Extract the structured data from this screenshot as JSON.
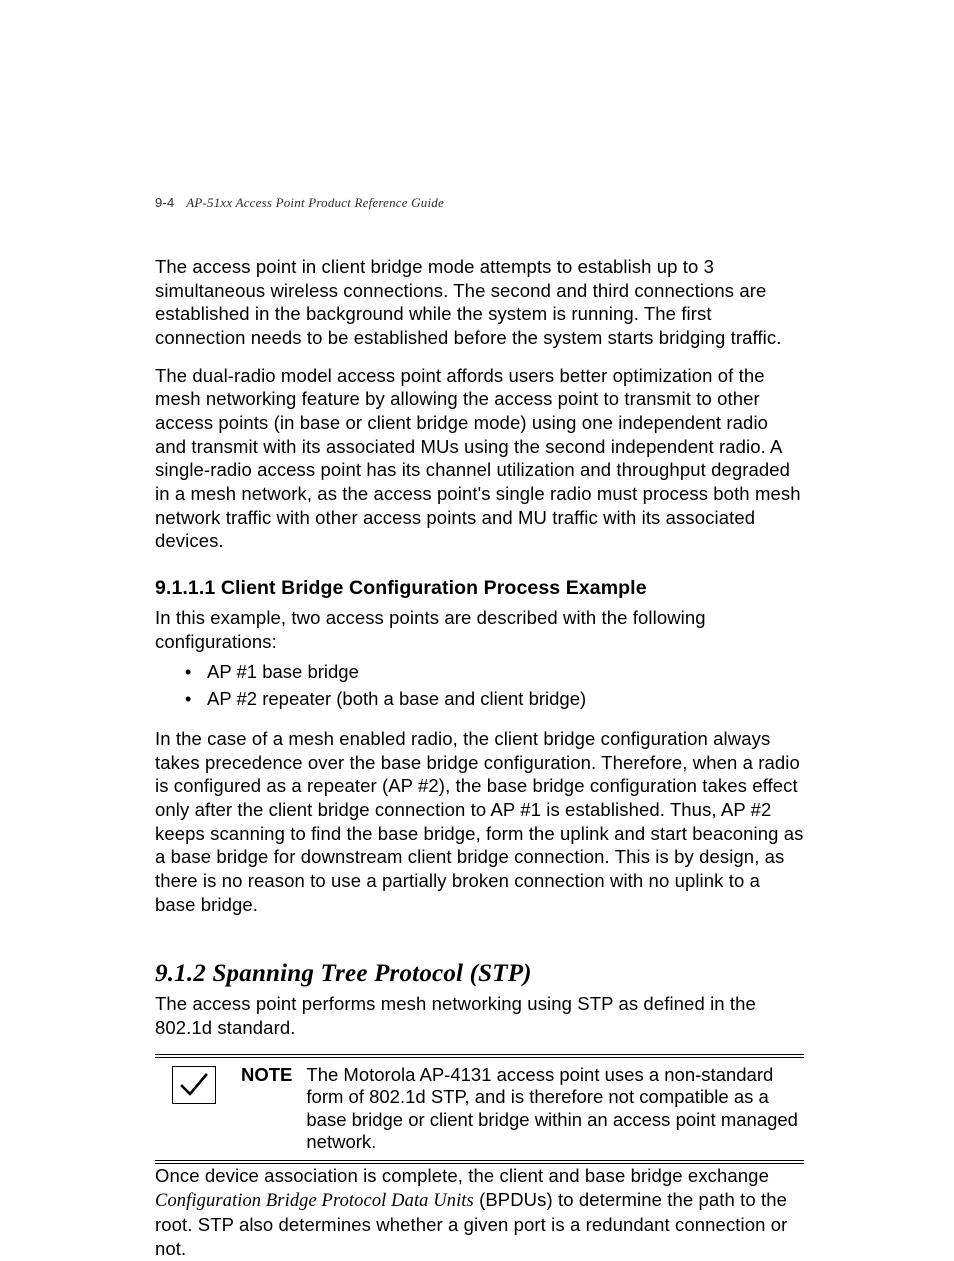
{
  "header": {
    "page_number": "9-4",
    "doc_title": "AP-51xx Access Point Product Reference Guide"
  },
  "paragraphs": {
    "p1": "The access point in client bridge mode attempts to establish up to 3 simultaneous wireless connections. The second and third connections are established in the background while the system is running. The first connection needs to be established before the system starts bridging traffic.",
    "p2": "The dual-radio model access point affords users better optimization of the mesh networking feature by allowing the access point to transmit to other access points (in base or client bridge mode) using one independent radio and transmit with its associated MUs using the second independent radio. A single-radio access point has its channel utilization and throughput degraded in a mesh network, as the access point's single radio must process both mesh network traffic with other access points and MU traffic with its associated devices.",
    "p3": "In this example, two access points are described with the following configurations:",
    "p4": "In the case of a mesh enabled radio, the client bridge configuration always takes precedence over the base bridge configuration. Therefore, when a radio is configured as a repeater (AP #2), the base bridge configuration takes effect only after the client bridge connection to AP #1 is established. Thus, AP #2 keeps scanning to find the base bridge, form the uplink and start beaconing as a base bridge for downstream client bridge connection. This is by design, as there is no reason to use a partially broken connection with no uplink to a base bridge.",
    "p5": "The access point performs mesh networking using STP as defined in the 802.1d standard.",
    "p6a": "Once device association is complete, the client and base bridge exchange ",
    "p6_ital": "Configuration Bridge Protocol Data Units",
    "p6b": " (BPDUs) to determine the path to the root. STP also determines whether a given port is a redundant connection or not."
  },
  "headings": {
    "h_9_1_1_1": "9.1.1.1 Client Bridge Configuration Process Example",
    "h_9_1_2": "9.1.2 Spanning Tree Protocol (STP)"
  },
  "bullets": {
    "b1": "AP #1 base bridge",
    "b2": "AP #2 repeater (both a base and client bridge)"
  },
  "note": {
    "label": "NOTE",
    "body": "The Motorola AP-4131 access point uses a non-standard form of 802.1d STP, and is therefore not compatible as a base bridge or client bridge within an access point managed network."
  }
}
